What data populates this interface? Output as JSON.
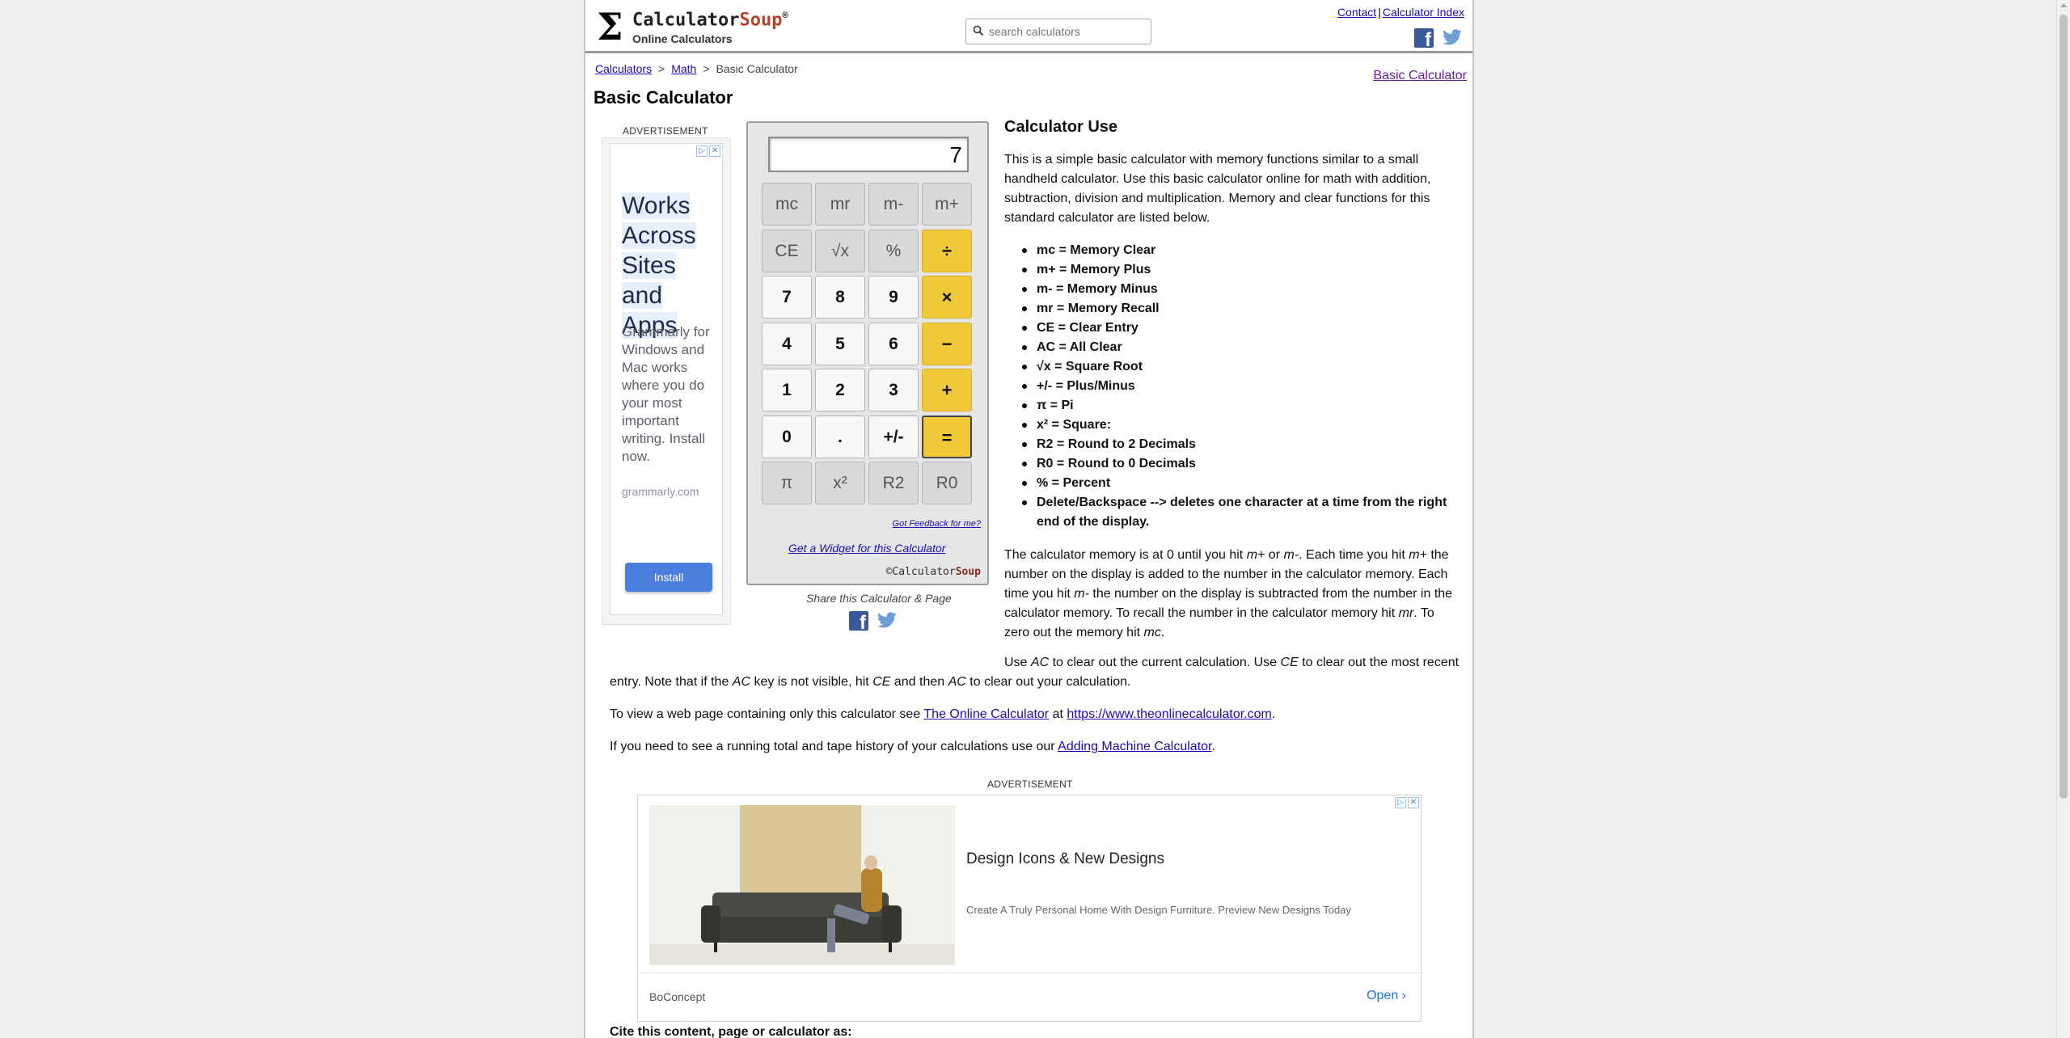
{
  "header": {
    "logo_name": "Calculator",
    "logo_soup": "Soup",
    "logo_reg": "®",
    "tagline": "Online Calculators",
    "search_placeholder": "search calculators",
    "link_contact": "Contact",
    "link_sep": "|",
    "link_index": "Calculator Index"
  },
  "breadcrumb": {
    "items": [
      "Calculators",
      "Math",
      "Basic Calculator"
    ],
    "separator": ">"
  },
  "side_link": "Basic Calculator",
  "page_title": "Basic Calculator",
  "ad_left": {
    "label": "ADVERTISEMENT",
    "headline_lines": [
      "Works",
      "Across",
      "Sites and",
      "Apps"
    ],
    "body": "Grammarly for Windows and Mac works where you do your most important writing. Install now.",
    "domain": "grammarly.com",
    "button": "Install"
  },
  "calculator": {
    "display": "7",
    "rows": [
      [
        {
          "label": "mc",
          "style": "gray",
          "name": "key-mc"
        },
        {
          "label": "mr",
          "style": "gray",
          "name": "key-mr"
        },
        {
          "label": "m-",
          "style": "gray",
          "name": "key-m-minus"
        },
        {
          "label": "m+",
          "style": "gray",
          "name": "key-m-plus"
        }
      ],
      [
        {
          "label": "CE",
          "style": "gray",
          "name": "key-ce"
        },
        {
          "label": "√x",
          "style": "gray",
          "name": "key-sqrt"
        },
        {
          "label": "%",
          "style": "gray",
          "name": "key-percent"
        },
        {
          "label": "÷",
          "style": "op",
          "name": "key-divide"
        }
      ],
      [
        {
          "label": "7",
          "style": "white",
          "name": "key-7"
        },
        {
          "label": "8",
          "style": "white",
          "name": "key-8"
        },
        {
          "label": "9",
          "style": "white",
          "name": "key-9"
        },
        {
          "label": "×",
          "style": "op",
          "name": "key-multiply"
        }
      ],
      [
        {
          "label": "4",
          "style": "white",
          "name": "key-4"
        },
        {
          "label": "5",
          "style": "white",
          "name": "key-5"
        },
        {
          "label": "6",
          "style": "white",
          "name": "key-6"
        },
        {
          "label": "−",
          "style": "op",
          "name": "key-subtract"
        }
      ],
      [
        {
          "label": "1",
          "style": "white",
          "name": "key-1"
        },
        {
          "label": "2",
          "style": "white",
          "name": "key-2"
        },
        {
          "label": "3",
          "style": "white",
          "name": "key-3"
        },
        {
          "label": "+",
          "style": "op",
          "name": "key-add"
        }
      ],
      [
        {
          "label": "0",
          "style": "white",
          "name": "key-0"
        },
        {
          "label": ".",
          "style": "white",
          "name": "key-decimal"
        },
        {
          "label": "+/-",
          "style": "white",
          "name": "key-plus-minus"
        },
        {
          "label": "=",
          "style": "op eq",
          "name": "key-equals"
        }
      ],
      [
        {
          "label": "π",
          "style": "gray",
          "name": "key-pi"
        },
        {
          "label": "x²",
          "style": "gray",
          "name": "key-square"
        },
        {
          "label": "R2",
          "style": "gray",
          "name": "key-r2"
        },
        {
          "label": "R0",
          "style": "gray",
          "name": "key-r0"
        }
      ]
    ],
    "feedback": "Got Feedback for me?",
    "widget": "Get a Widget for this Calculator",
    "copyright_symbol": "©",
    "copyright_name": "Calculator",
    "copyright_soup": "Soup",
    "share_label": "Share this Calculator & Page"
  },
  "content": {
    "use_title": "Calculator Use",
    "intro": "This is a simple basic calculator with memory functions similar to a small handheld calculator. Use this basic calculator online for math with addition, subtraction, division and multiplication. Memory and clear functions for this standard calculator are listed below.",
    "legend": [
      "mc = Memory Clear",
      "m+ = Memory Plus",
      "m- = Memory Minus",
      "mr = Memory Recall",
      "CE = Clear Entry",
      "AC = All Clear",
      "√x = Square Root",
      "+/- = Plus/Minus",
      "π = Pi",
      "x² = Square:",
      "R2 = Round to 2 Decimals",
      "R0 = Round to 0 Decimals",
      "% = Percent",
      "Delete/Backspace --> deletes one character at a time from the right end of the display."
    ],
    "memory_para": {
      "t1": "The calculator memory is at 0 until you hit ",
      "i1": "m+",
      "t2": " or ",
      "i2": "m-",
      "t3": ". Each time you hit ",
      "i3": "m+",
      "t4": " the number on the display is added to the number in the calculator memory. Each time you hit ",
      "i4": "m-",
      "t5": " the number on the display is subtracted from the number in the calculator memory. To recall the number in the calculator memory hit ",
      "i5": "mr",
      "t6": ". To zero out the memory hit ",
      "i6": "mc",
      "t7": "."
    },
    "ac_para": {
      "t1": "Use ",
      "i1": "AC",
      "t2": " to clear out the current calculation. Use ",
      "i2": "CE",
      "t3": " to clear out the most recent entry. Note that if the ",
      "i3": "AC",
      "t4": " key is not visible, hit ",
      "i4": "CE",
      "t5": " and then ",
      "i5": "AC",
      "t6": " to clear out your calculation."
    },
    "view_para": {
      "t1": "To view a web page containing only this calculator see ",
      "link1": "The Online Calculator",
      "t2": " at ",
      "link2": "https://www.theonlinecalculator.com",
      "t3": "."
    },
    "tape_para": {
      "t1": "If you need to see a running total and tape history of your calculations use our ",
      "link1": "Adding Machine Calculator",
      "t2": "."
    }
  },
  "ad_bottom": {
    "label": "ADVERTISEMENT",
    "headline": "Design Icons & New Designs",
    "description": "Create A Truly Personal Home With Design Furniture. Preview New Designs Today",
    "brand": "BoConcept",
    "open": "Open"
  },
  "cite": "Cite this content, page or calculator as:",
  "colors": {
    "operator_key": "#f0c93a",
    "link": "#1a0dab",
    "facebook": "#3b5998",
    "twitter": "#55acee",
    "soup_brand": "#b5442a"
  }
}
